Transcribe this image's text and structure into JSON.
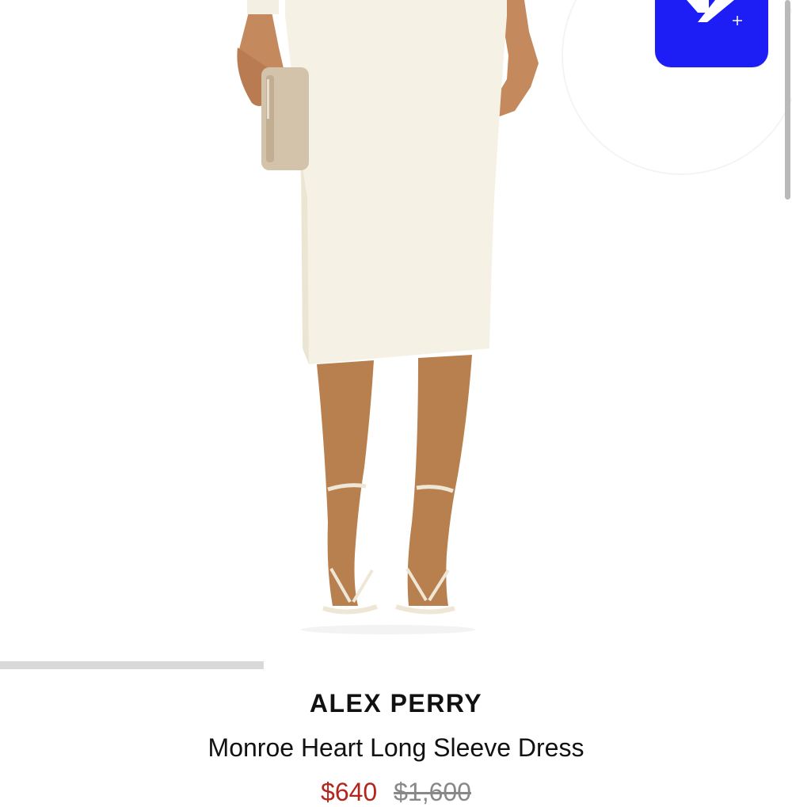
{
  "product": {
    "brand": "ALEX PERRY",
    "name": "Monroe Heart Long Sleeve Dress",
    "sale_price": "$640",
    "original_price": "$1,600",
    "image_alt": "Model wearing ivory midi dress with strappy sandals holding a beige clutch"
  },
  "carousel": {
    "progress_fraction": 0.333
  },
  "badge": {
    "icon": "add-to-list-icon",
    "color": "#1d1df6"
  },
  "colors": {
    "sale": "#b3261e",
    "original": "#888888",
    "text": "#111111"
  }
}
